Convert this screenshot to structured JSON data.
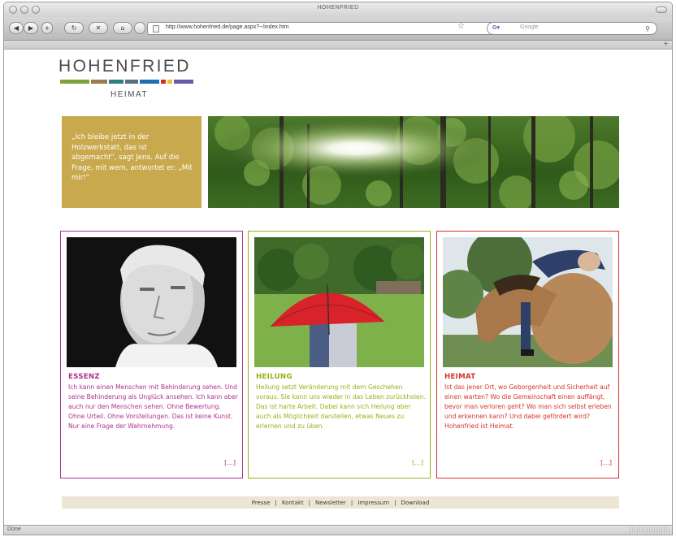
{
  "browser": {
    "window_title": "HOHENFRIED",
    "url": "http://www.hohenfried.de/page.aspx?~/index.htm",
    "search_placeholder": "Google",
    "status_text": "Done",
    "nav": {
      "back": "◀",
      "forward": "▶",
      "reload": "↻",
      "stop": "✕",
      "home": "⌂",
      "add": "+"
    }
  },
  "logo": {
    "title": "HOHENFRIED",
    "subtitle": "HEIMAT",
    "bar_colors": [
      "#7fa33b",
      "#9b7a4e",
      "#2d7f86",
      "#5a6e7d",
      "#1f6fb6",
      "#d72a23",
      "#e8c330",
      "#6b5aa8"
    ]
  },
  "hero": {
    "quote": "„Ich bleibe jetzt in der Holzwerkstatt, das ist abgemacht\", sagt Jens. Auf die Frage, mit wem, antwortet er: „Mit mir!\"",
    "quote_bg": "#c9a94d"
  },
  "cards": [
    {
      "title": "ESSENZ",
      "text": "Ich kann einen Menschen mit Behinderung sehen. Und seine Behinderung als Unglück ansehen. Ich kann aber auch nur den Menschen sehen. Ohne Bewertung. Ohne Urteil. Ohne Vorstellungen. Das ist keine Kunst. Nur eine Frage der Wahrnehmung.",
      "more": "[...]",
      "color": "#b0308e"
    },
    {
      "title": "HEILUNG",
      "text": "Heilung setzt Veränderung mit dem Geschehen voraus. Sie kann uns wieder in das Leben zurückholen. Das ist harte Arbeit. Dabei kann sich Heilung aber auch als Möglichkeit darstellen, etwas Neues zu erlernen und zu üben.",
      "more": "[...]",
      "color": "#9bb018"
    },
    {
      "title": "HEIMAT",
      "text": "Ist das jener Ort, wo Geborgenheit und Sicherheit auf einen warten? Wo die Gemeinschaft einen auffängt, bevor man verloren geht? Wo man sich selbst erleben und erkennen kann? Und dabei gefördert wird? Hohenfried ist Heimat.",
      "more": "[...]",
      "color": "#d8322a"
    }
  ],
  "footer": {
    "links": [
      "Presse",
      "Kontakt",
      "Newsletter",
      "Impressum",
      "Download"
    ],
    "separator": "|"
  }
}
